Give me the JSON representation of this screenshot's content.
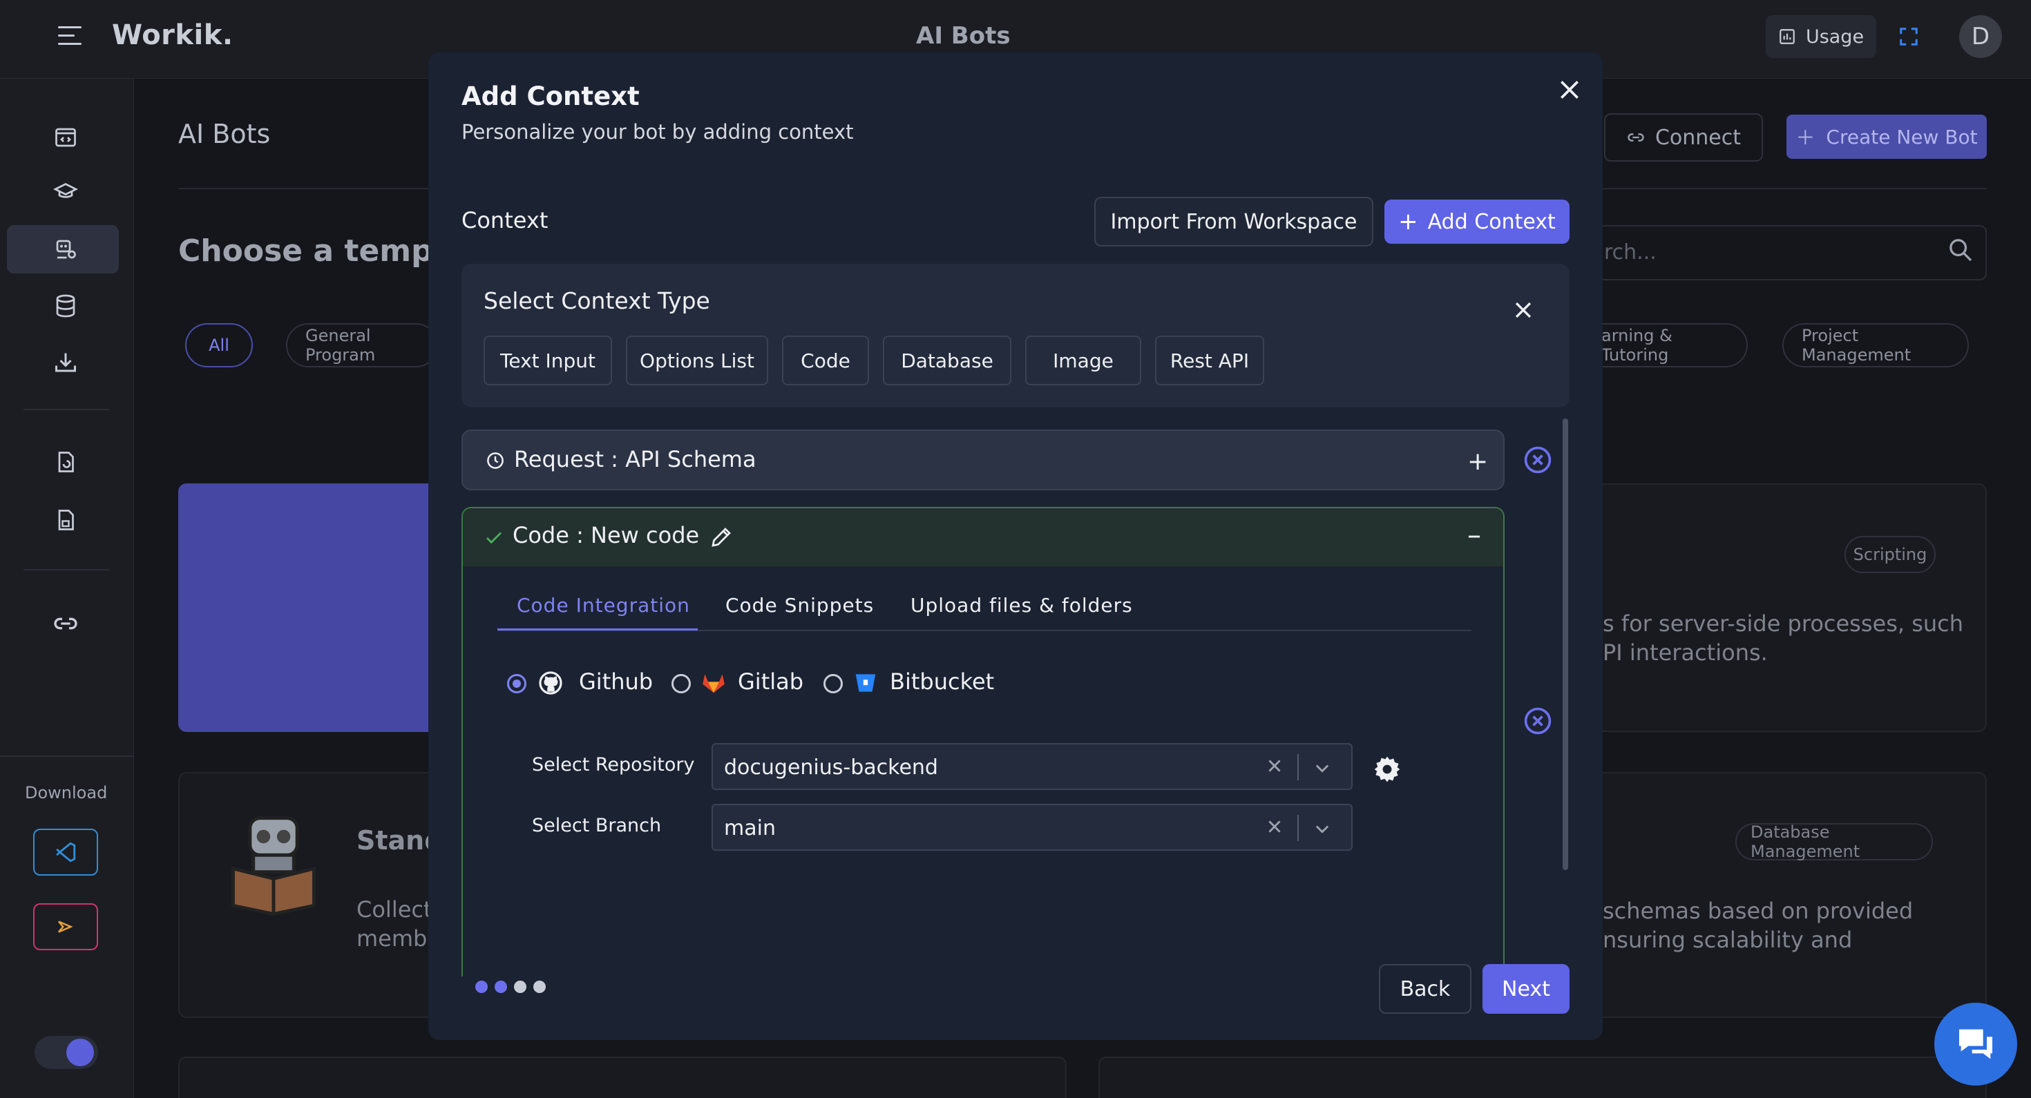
{
  "app": {
    "brand": "Workik.",
    "top_title": "AI Bots",
    "usage_label": "Usage",
    "avatar_initial": "D"
  },
  "sidebar": {
    "download_label": "Download"
  },
  "background": {
    "page_title": "AI Bots",
    "choose_template": "Choose a templat",
    "connect_label": "Connect",
    "create_label": "Create New Bot",
    "search_placeholder": "rch...",
    "chips": [
      "All",
      "General Program",
      "arning & Tutoring",
      "Project Management"
    ],
    "card1_tag": "Scripting",
    "card1_text_line1": "s for server-side processes, such",
    "card1_text_line2": "PI interactions.",
    "card2_title": "Stand",
    "card2_text_line1": "Collect",
    "card2_text_line2": "membe",
    "card3_tag": "Database Management",
    "card3_text_line1": "schemas based on provided",
    "card3_text_line2": "nsuring scalability and"
  },
  "modal": {
    "title": "Add Context",
    "subtitle": "Personalize your bot by adding context",
    "context_label": "Context",
    "import_button": "Import From Workspace",
    "add_button": "Add Context",
    "type_panel": {
      "title": "Select Context Type",
      "types": [
        "Text Input",
        "Options List",
        "Code",
        "Database",
        "Image",
        "Rest API"
      ]
    },
    "request_item": {
      "label": "Request : API Schema"
    },
    "code_item": {
      "label": "Code : New code",
      "tabs": [
        "Code Integration",
        "Code Snippets",
        "Upload files & folders"
      ],
      "active_tab": "Code Integration",
      "providers": [
        "Github",
        "Gitlab",
        "Bitbucket"
      ],
      "selected_provider": "Github",
      "repo_label": "Select Repository",
      "repo_value": "docugenius-backend",
      "branch_label": "Select Branch",
      "branch_value": "main"
    },
    "steps": {
      "total": 4,
      "current": 2
    },
    "back_button": "Back",
    "next_button": "Next"
  },
  "colors": {
    "accent": "#5f63e6",
    "accent_text": "#7f83f2",
    "success_border": "#3c7a46",
    "modal_bg": "#1b2232"
  }
}
